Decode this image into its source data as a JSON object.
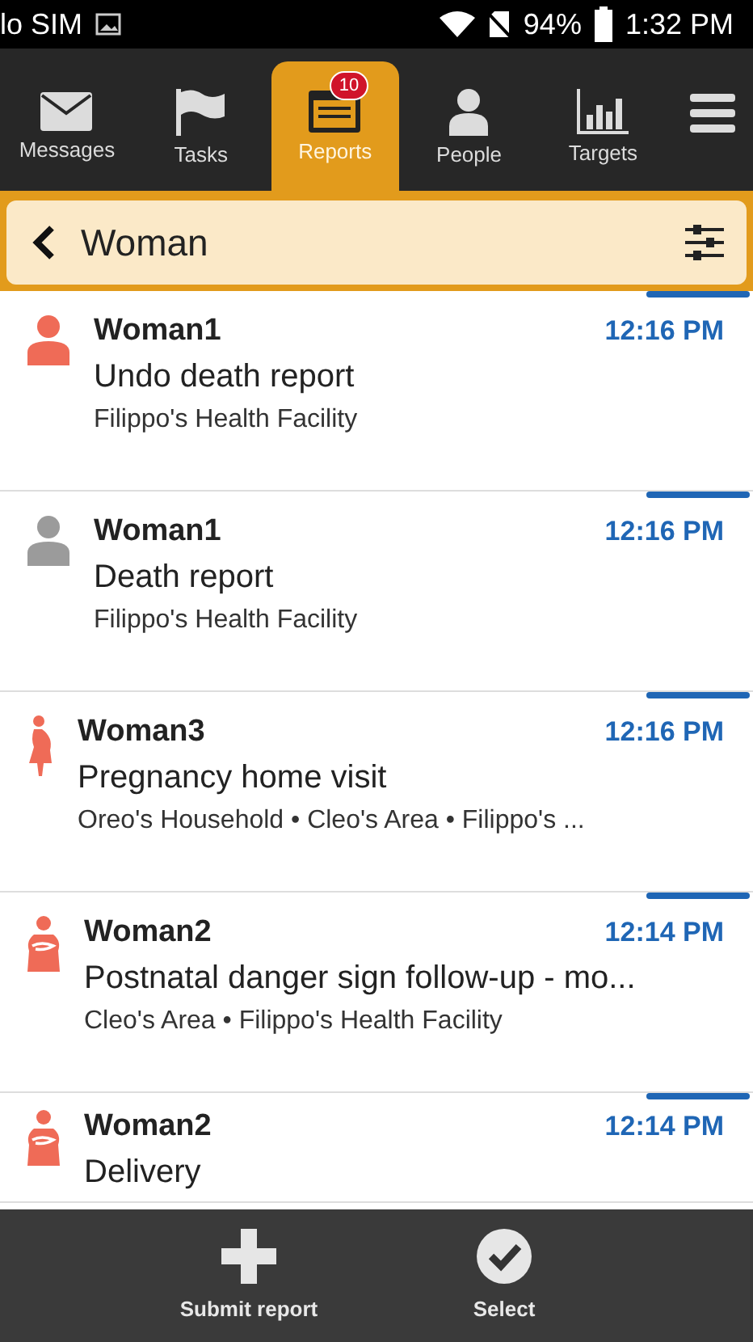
{
  "status_bar": {
    "carrier": "lo SIM",
    "battery": "94%",
    "time": "1:32 PM"
  },
  "tabs": [
    {
      "label": "Messages",
      "kind": "messages",
      "selected": false
    },
    {
      "label": "Tasks",
      "kind": "tasks",
      "selected": false
    },
    {
      "label": "Reports",
      "kind": "reports",
      "selected": true,
      "badge": "10"
    },
    {
      "label": "People",
      "kind": "people",
      "selected": false
    },
    {
      "label": "Targets",
      "kind": "targets",
      "selected": false
    }
  ],
  "filter_bar": {
    "title": "Woman"
  },
  "reports": [
    {
      "name": "Woman1",
      "time": "12:16 PM",
      "form": "Undo death report",
      "place": "Filippo's Health Facility",
      "kind": "person",
      "color": "#ef6b57"
    },
    {
      "name": "Woman1",
      "time": "12:16 PM",
      "form": "Death report",
      "place": "Filippo's Health Facility",
      "kind": "person",
      "color": "#9b9b9b"
    },
    {
      "name": "Woman3",
      "time": "12:16 PM",
      "form": "Pregnancy home visit",
      "place": "Oreo's Household • Cleo's Area • Filippo's ...",
      "kind": "pregnant",
      "color": "#ef6b57"
    },
    {
      "name": "Woman2",
      "time": "12:14 PM",
      "form": "Postnatal danger sign follow-up - mo...",
      "place": "Cleo's Area • Filippo's Health Facility",
      "kind": "mother",
      "color": "#ef6b57"
    },
    {
      "name": "Woman2",
      "time": "12:14 PM",
      "form": "Delivery",
      "kind": "mother",
      "color": "#ef6b57"
    }
  ],
  "actions": [
    {
      "label": "Submit report",
      "kind": "add"
    },
    {
      "label": "Select",
      "kind": "select"
    }
  ]
}
